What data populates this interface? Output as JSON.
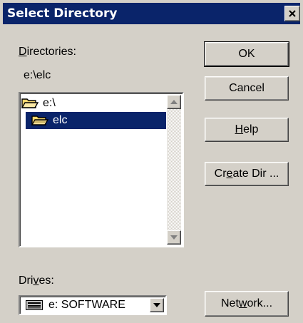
{
  "window": {
    "title": "Select Directory",
    "close_glyph": "✕"
  },
  "directories": {
    "label_mnemonic": "D",
    "label_rest": "irectories:",
    "current_path": "e:\\elc",
    "items": [
      {
        "label": "e:\\",
        "icon": "open-folder-icon",
        "selected": false
      },
      {
        "label": "elc",
        "icon": "open-folder-icon",
        "selected": true
      }
    ]
  },
  "drives": {
    "label_pre": "Dri",
    "label_mnemonic": "v",
    "label_post": "es:",
    "selected": "e: SOFTWARE",
    "icon": "drive-icon"
  },
  "buttons": {
    "ok": "OK",
    "cancel": "Cancel",
    "help_mnemonic": "H",
    "help_rest": "elp",
    "create_pre": "Cr",
    "create_mnemonic": "e",
    "create_post": "ate Dir ...",
    "network_pre": "Net",
    "network_mnemonic": "w",
    "network_post": "ork..."
  },
  "colors": {
    "titlebar": "#0a246a",
    "selection": "#0a246a",
    "face": "#d4d0c8",
    "folder": "#f5d76e"
  }
}
